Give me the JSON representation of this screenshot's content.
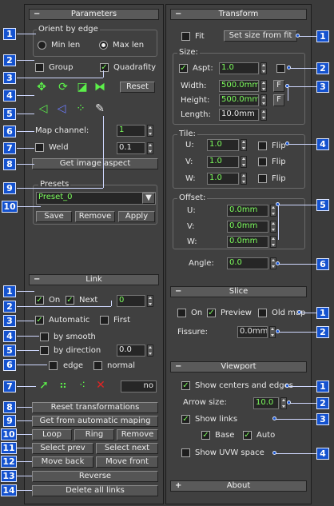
{
  "left": {
    "parameters": {
      "header": "Parameters",
      "orient_title": "Orient by edge",
      "min_len": "Min len",
      "max_len": "Max len",
      "group": "Group",
      "quadrafity": "Quadrafity",
      "reset": "Reset",
      "map_channel_label": "Map channel:",
      "map_channel_value": "1",
      "weld": "Weld",
      "weld_value": "0.1",
      "get_image_aspect": "Get image aspect",
      "presets_title": "Presets",
      "preset_value": "Preset_0",
      "save": "Save",
      "remove": "Remove",
      "apply": "Apply"
    },
    "link": {
      "header": "Link",
      "on": "On",
      "next": "Next",
      "next_value": "0",
      "automatic": "Automatic",
      "first": "First",
      "by_smooth": "by smooth",
      "by_direction": "by direction",
      "by_direction_value": "0.0",
      "edge": "edge",
      "normal": "normal",
      "no_field": "no",
      "reset_transformations": "Reset transformations",
      "get_from_automatic": "Get from automatic maping",
      "loop": "Loop",
      "ring": "Ring",
      "remove": "Remove",
      "select_prev": "Select prev",
      "select_next": "Select next",
      "move_back": "Move back",
      "move_front": "Move front",
      "reverse": "Reverse",
      "delete_all": "Delete all links"
    },
    "markers": [
      "1",
      "2",
      "3",
      "4",
      "5",
      "6",
      "7",
      "8",
      "9",
      "10",
      "1",
      "2",
      "3",
      "4",
      "5",
      "6",
      "7",
      "8",
      "9",
      "10",
      "11",
      "12",
      "13",
      "14"
    ]
  },
  "right": {
    "transform": {
      "header": "Transform",
      "fit": "Fit",
      "set_size_from_fit": "Set size from fit",
      "size_title": "Size:",
      "aspt": "Aspt:",
      "aspt_value": "1.0",
      "width_label": "Width:",
      "width_value": "500.0mm",
      "height_label": "Height:",
      "height_value": "500.0mm",
      "f1": "F",
      "f2": "F",
      "length_label": "Length:",
      "length_value": "10.0mm",
      "tile_title": "Tile:",
      "u": "U:",
      "v": "V:",
      "w": "W:",
      "tile_u": "1.0",
      "tile_v": "1.0",
      "tile_w": "1.0",
      "flip": "Flip",
      "offset_title": "Offset:",
      "off_u": "0.0mm",
      "off_v": "0.0mm",
      "off_w": "0.0mm",
      "angle_label": "Angle:",
      "angle_value": "0.0"
    },
    "slice": {
      "header": "Slice",
      "on": "On",
      "preview": "Preview",
      "old_map": "Old map",
      "fissure_label": "Fissure:",
      "fissure_value": "0.0mm"
    },
    "viewport": {
      "header": "Viewport",
      "show_centers": "Show centers and edges",
      "arrow_size_label": "Arrow size:",
      "arrow_size_value": "10.0",
      "show_links": "Show links",
      "base": "Base",
      "auto": "Auto",
      "show_uvw": "Show UVW space"
    },
    "about": {
      "header": "About"
    },
    "markers": [
      "1",
      "2",
      "3",
      "4",
      "5",
      "6",
      "1",
      "2",
      "1",
      "2",
      "3",
      "4"
    ]
  },
  "colors": {
    "accent_value": "#7cfc5c",
    "marker_blue": "#1452cf",
    "panel_bg": "#404040"
  }
}
